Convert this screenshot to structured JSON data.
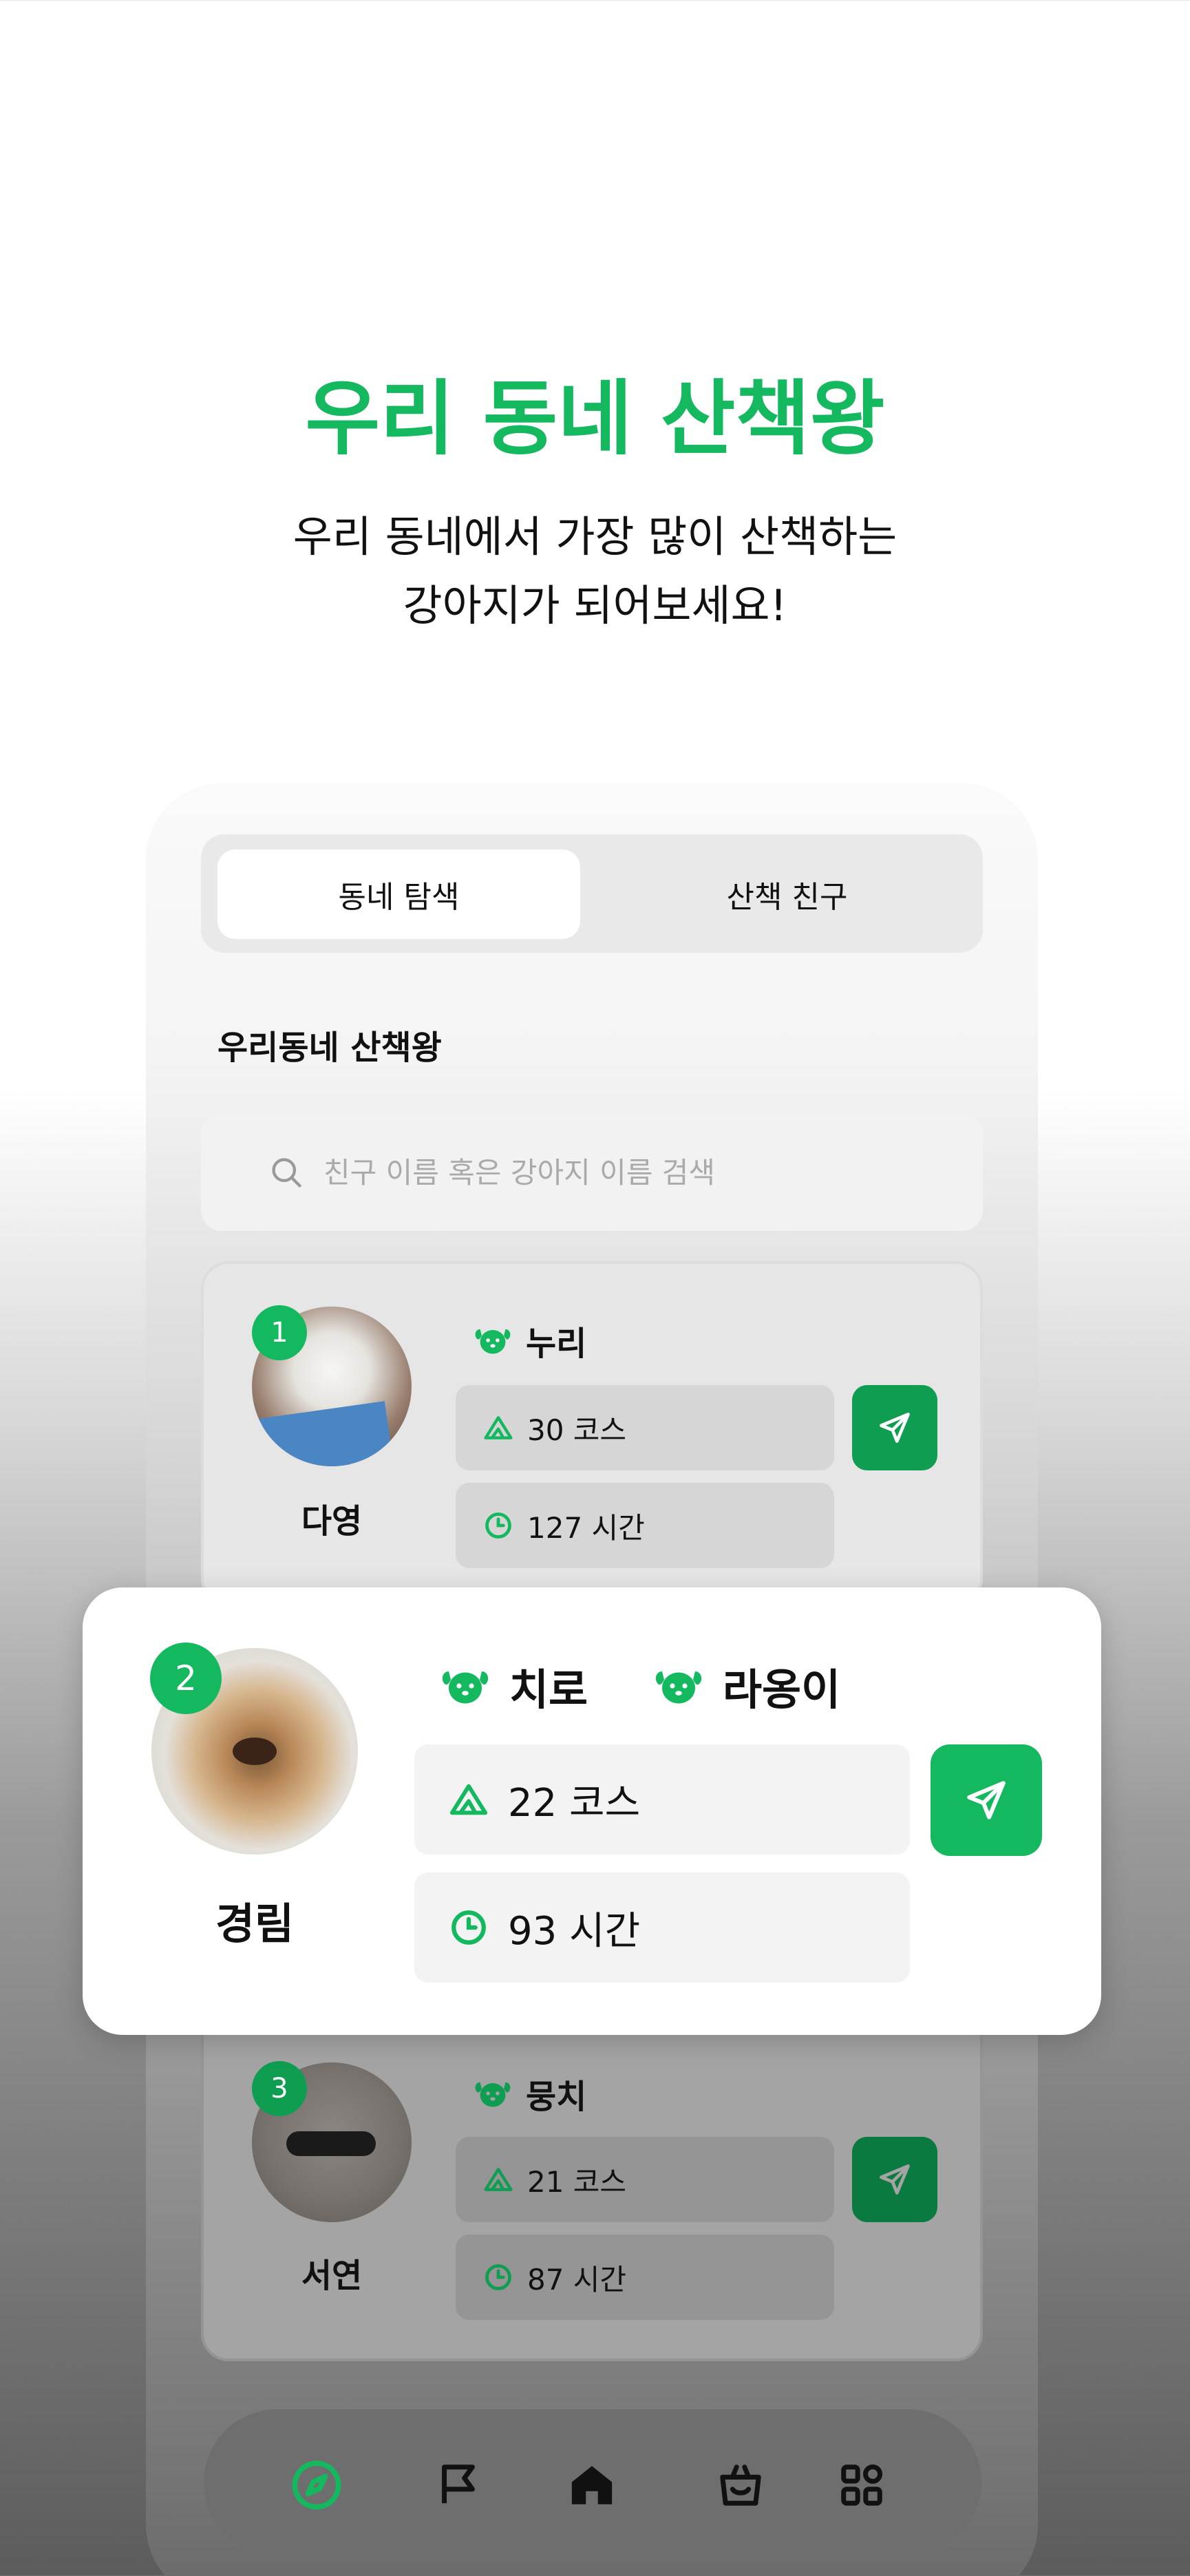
{
  "hero": {
    "title": "우리 동네 산책왕",
    "subtitle_line1": "우리 동네에서 가장 많이 산책하는",
    "subtitle_line2": "강아지가 되어보세요!"
  },
  "tabs": [
    {
      "label": "동네 탐색",
      "active": true
    },
    {
      "label": "산책 친구",
      "active": false
    }
  ],
  "section_title": "우리동네 산책왕",
  "search": {
    "placeholder": "친구 이름 혹은 강아지 이름 검색"
  },
  "rankings": [
    {
      "rank": "1",
      "owner": "다영",
      "dogs": [
        "누리"
      ],
      "courses": "30 코스",
      "hours": "127 시간"
    },
    {
      "rank": "2",
      "owner": "경림",
      "dogs": [
        "치로",
        "라옹이"
      ],
      "courses": "22 코스",
      "hours": "93 시간"
    },
    {
      "rank": "3",
      "owner": "서연",
      "dogs": [
        "뭉치"
      ],
      "courses": "21 코스",
      "hours": "87 시간"
    }
  ],
  "nav": [
    "compass-icon",
    "flag-icon",
    "home-icon",
    "shopping-bag-icon",
    "grid-icon"
  ],
  "colors": {
    "accent": "#13b85f",
    "text": "#111111"
  }
}
